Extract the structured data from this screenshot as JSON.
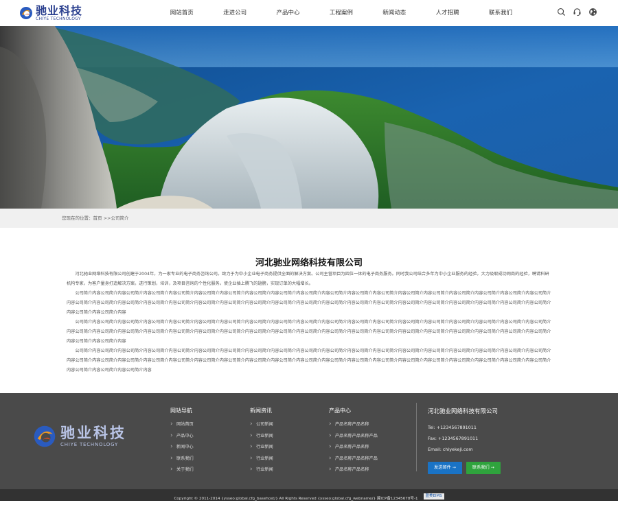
{
  "header": {
    "logo_cn": "驰业科技",
    "logo_en": "CHIYE TECHNOLOGY",
    "nav": [
      "网站首页",
      "走进公司",
      "产品中心",
      "工程案例",
      "新闻动态",
      "人才招聘",
      "联系我们"
    ],
    "icons": [
      "search-icon",
      "headset-icon",
      "globe-icon"
    ]
  },
  "breadcrumb": "您现在的位置：首页 >>公司简介",
  "content": {
    "title": "河北驰业网络科技有限公司",
    "intro": "河北驰业网络科技有限公司创建于2004年，为一家专业的电子商务咨询公司。致力于为中小企业电子商务提供全面的解决方案。公司主营项目为四位一体的电子商务服务。同时我公司结合多年为中小企业服务的经验，大力吸取成功网商的经验，聘请科研机构专家，为客户量身打造解决方案。进行策划，培训，及项目咨询的个性化服务。使企业插上腾飞的翅膀，实现订单的大幅增长。",
    "para1": "公司简介内容公司简介内容公司简介内容公司简介内容公司简介内容公司简介内容公司简介内容公司简介内容公司简介内容公司简介内容公司简介内容公司简介内容公司简介内容公司简介内容公司简介内容公司简介内容公司简介内容公司简介内容公司简介内容公司简介内容公司简介内容公司简介内容公司简介内容公司简介内容公司简介内容公司简介内容公司简介内容公司简介内容公司简介内容公司简介内容公司简介内容公司简介内容公司简介内容公司简介内容公司简介内容公司简介内容公司简介内容公司简介内容公司简介内容公司简介内容",
    "para2": "公司简介内容公司简介内容公司简介内容公司简介内容公司简介内容公司简介内容公司简介内容公司简介内容公司简介内容公司简介内容公司简介内容公司简介内容公司简介内容公司简介内容公司简介内容公司简介内容公司简介内容公司简介内容公司简介内容公司简介内容公司简介内容公司简介内容公司简介内容公司简介内容公司简介内容公司简介内容公司简介内容公司简介内容公司简介内容公司简介内容公司简介内容公司简介内容公司简介内容公司简介内容公司简介内容公司简介内容公司简介内容公司简介内容公司简介内容公司简介内容",
    "para3": "公司简介内容公司简介内容公司简介内容公司简介内容公司简介内容公司简介内容公司简介内容公司简介内容公司简介内容公司简介内容公司简介内容公司简介内容公司简介内容公司简介内容公司简介内容公司简介内容公司简介内容公司简介内容公司简介内容公司简介内容公司简介内容公司简介内容公司简介内容公司简介内容公司简介内容公司简介内容公司简介内容公司简介内容公司简介内容公司简介内容公司简介内容公司简介内容公司简介内容公司简介内容公司简介内容公司简介内容公司简介内容公司简介内容公司简介内容公司简介内容公司简介内容"
  },
  "footer": {
    "logo_cn": "驰业科技",
    "logo_en": "CHIYE TECHNOLOGY",
    "col1": {
      "title": "网站导航",
      "items": [
        "网站首页",
        "产品中心",
        "新闻中心",
        "联系我们",
        "关于我们"
      ]
    },
    "col2": {
      "title": "新闻资讯",
      "items": [
        "公司新闻",
        "行业新闻",
        "行业新闻",
        "行业新闻",
        "行业新闻"
      ]
    },
    "col3": {
      "title": "产品中心",
      "items": [
        "产品名称产品名称",
        "产品名称产品名称产品",
        "产品名称产品名称",
        "产品名称产品名称产品",
        "产品名称产品名称"
      ]
    },
    "contact": {
      "title": "河北驰业网络科技有限公司",
      "tel": "Tel: +1234567891011",
      "fax": "Fax: +1234567891011",
      "email": "Email: chiyekeji.com",
      "btn_mail": "发送邮件 →",
      "btn_contact": "联系我们 →"
    },
    "copyright": "Copyright © 2011-2014 {ysseo:global.cfg_basehost/} All Rights Reserved {ysseo:global.cfg_webname/} 冀ICP备12345678号-1",
    "badge": "盈美EIMS"
  }
}
